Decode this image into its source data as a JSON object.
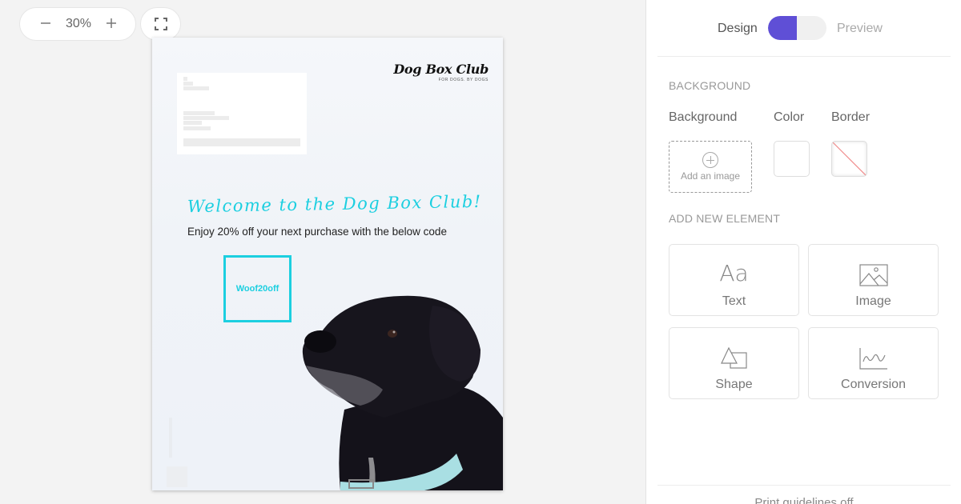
{
  "canvas": {
    "zoom": {
      "decrease_icon": "minus-icon",
      "value": "30%",
      "increase_icon": "plus-icon"
    },
    "fullscreen_icon": "fullscreen-icon",
    "page": {
      "logo": {
        "title": "Dog Box Club",
        "tagline": "FOR DOGS. BY DOGS"
      },
      "headline": "Welcome to the Dog Box Club!",
      "subline": "Enjoy 20% off your next purchase with the below code",
      "coupon_code": "Woof20off",
      "accent_color": "#1ccfe0",
      "image": "black-dog-photo"
    }
  },
  "sidebar": {
    "mode": {
      "design_label": "Design",
      "preview_label": "Preview",
      "active": "Design",
      "toggle_color": "#5f4fd6"
    },
    "background_section": {
      "title": "BACKGROUND",
      "labels": {
        "background": "Background",
        "color": "Color",
        "border": "Border"
      },
      "add_image_label": "Add an image",
      "color_value": "#ffffff",
      "border_value": "none"
    },
    "add_element_section": {
      "title": "ADD NEW ELEMENT",
      "items": [
        {
          "label": "Text",
          "icon": "text-icon",
          "glyph": "Aa"
        },
        {
          "label": "Image",
          "icon": "image-icon"
        },
        {
          "label": "Shape",
          "icon": "shape-icon"
        },
        {
          "label": "Conversion",
          "icon": "chart-icon"
        }
      ]
    },
    "footer_text": "Print guidelines off"
  }
}
